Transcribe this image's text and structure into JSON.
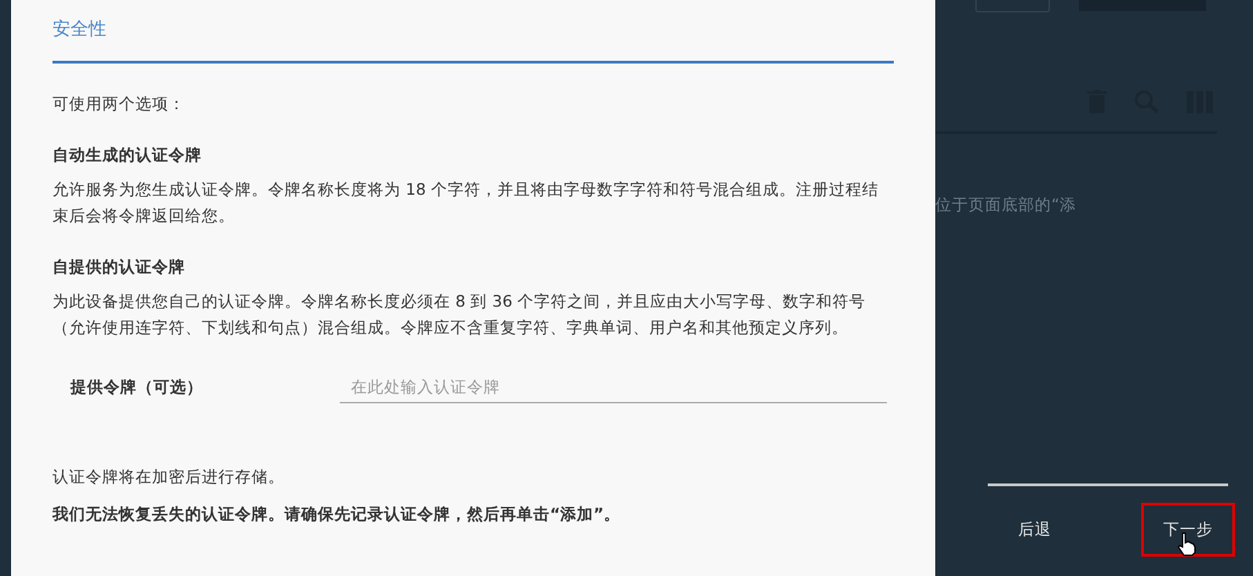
{
  "dialog": {
    "title": "安全性",
    "intro": "可使用两个选项：",
    "sections": [
      {
        "heading": "自动生成的认证令牌",
        "body": "允许服务为您生成认证令牌。令牌名称长度将为 18 个字符，并且将由字母数字字符和符号混合组成。注册过程结束后会将令牌返回给您。"
      },
      {
        "heading": "自提供的认证令牌",
        "body": "为此设备提供您自己的认证令牌。令牌名称长度必须在 8 到 36 个字符之间，并且应由大小写字母、数字和符号（允许使用连字符、下划线和句点）混合组成。令牌应不含重复字符、字典单词、用户名和其他预定义序列。"
      }
    ],
    "field": {
      "label": "提供令牌（可选）",
      "placeholder": "在此处输入认证令牌"
    },
    "note": "认证令牌将在加密后进行存储。",
    "warning": "我们无法恢复丢失的认证令牌。请确保先记录认证令牌，然后再单击“添加”。"
  },
  "background": {
    "text": "位于页面底部的“添"
  },
  "nav": {
    "buttons": [
      {
        "label": "后退",
        "highlighted": false
      },
      {
        "label": "下一步",
        "highlighted": true
      }
    ]
  }
}
